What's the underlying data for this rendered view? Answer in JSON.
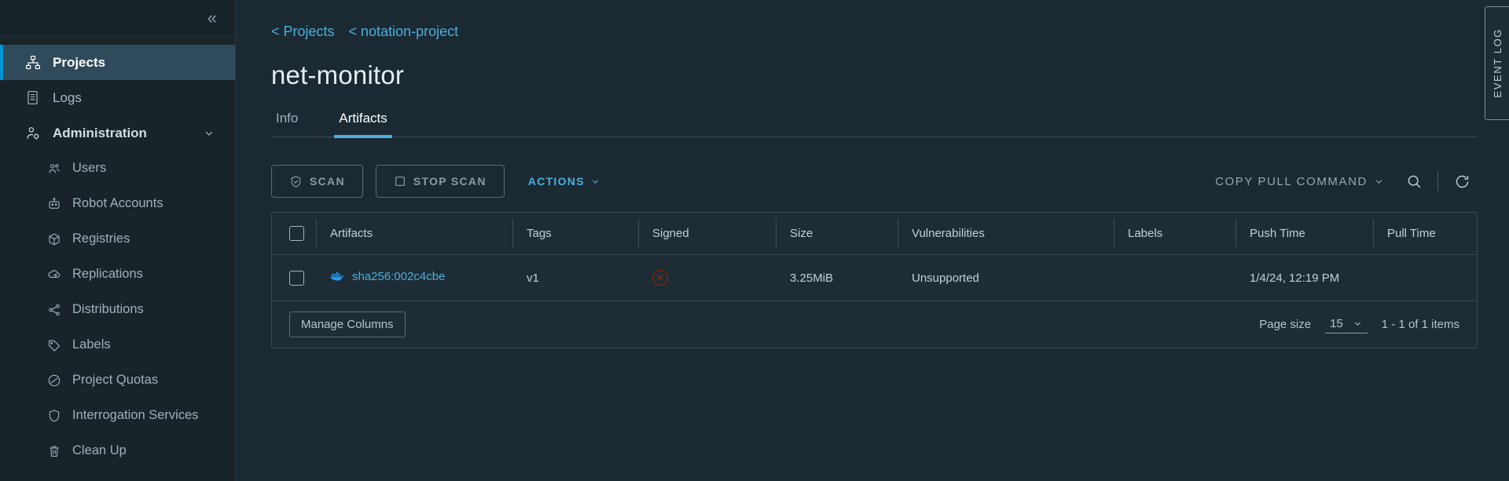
{
  "sidebar": {
    "collapse_icon": "«",
    "items": [
      {
        "label": "Projects",
        "icon": "projects-icon",
        "active": true
      },
      {
        "label": "Logs",
        "icon": "logs-icon",
        "active": false
      },
      {
        "label": "Administration",
        "icon": "administration-icon",
        "active": false,
        "expanded": true,
        "caret": "⌄"
      }
    ],
    "sub_items": [
      {
        "label": "Users",
        "icon": "users-icon"
      },
      {
        "label": "Robot Accounts",
        "icon": "robot-icon"
      },
      {
        "label": "Registries",
        "icon": "registries-icon"
      },
      {
        "label": "Replications",
        "icon": "replications-icon"
      },
      {
        "label": "Distributions",
        "icon": "distributions-icon"
      },
      {
        "label": "Labels",
        "icon": "labels-icon"
      },
      {
        "label": "Project Quotas",
        "icon": "quotas-icon"
      },
      {
        "label": "Interrogation Services",
        "icon": "interrogation-icon"
      },
      {
        "label": "Clean Up",
        "icon": "cleanup-icon"
      }
    ]
  },
  "breadcrumb": {
    "projects": "< Projects",
    "project": "< notation-project"
  },
  "page_title": "net-monitor",
  "tabs": [
    {
      "label": "Info",
      "active": false
    },
    {
      "label": "Artifacts",
      "active": true
    }
  ],
  "toolbar": {
    "scan_label": "SCAN",
    "stop_scan_label": "STOP SCAN",
    "actions_label": "ACTIONS",
    "actions_caret": "⌄",
    "copy_pull_label": "COPY PULL COMMAND",
    "copy_pull_caret": "⌄",
    "search_icon": "search-icon",
    "refresh_icon": "refresh-icon"
  },
  "table": {
    "columns": [
      "Artifacts",
      "Tags",
      "Signed",
      "Size",
      "Vulnerabilities",
      "Labels",
      "Push Time",
      "Pull Time"
    ],
    "rows": [
      {
        "artifact": "sha256:002c4cbe",
        "artifact_icon": "docker-whale-icon",
        "tags": "v1",
        "signed": "not-signed-icon",
        "size": "3.25MiB",
        "vulnerabilities": "Unsupported",
        "labels": "",
        "push_time": "1/4/24, 12:19 PM",
        "pull_time": ""
      }
    ]
  },
  "footer": {
    "manage_columns": "Manage Columns",
    "page_size_label": "Page size",
    "page_size_value": "15",
    "page_size_caret": "⌄",
    "items_range": "1 - 1 of 1 items"
  },
  "event_log": {
    "label": "EVENT LOG"
  },
  "colors": {
    "accent": "#4aaede",
    "active_nav_bar": "#0095d3",
    "sidebar_bg": "#18232a",
    "page_bg": "#1b2a32",
    "danger": "#a32100"
  }
}
